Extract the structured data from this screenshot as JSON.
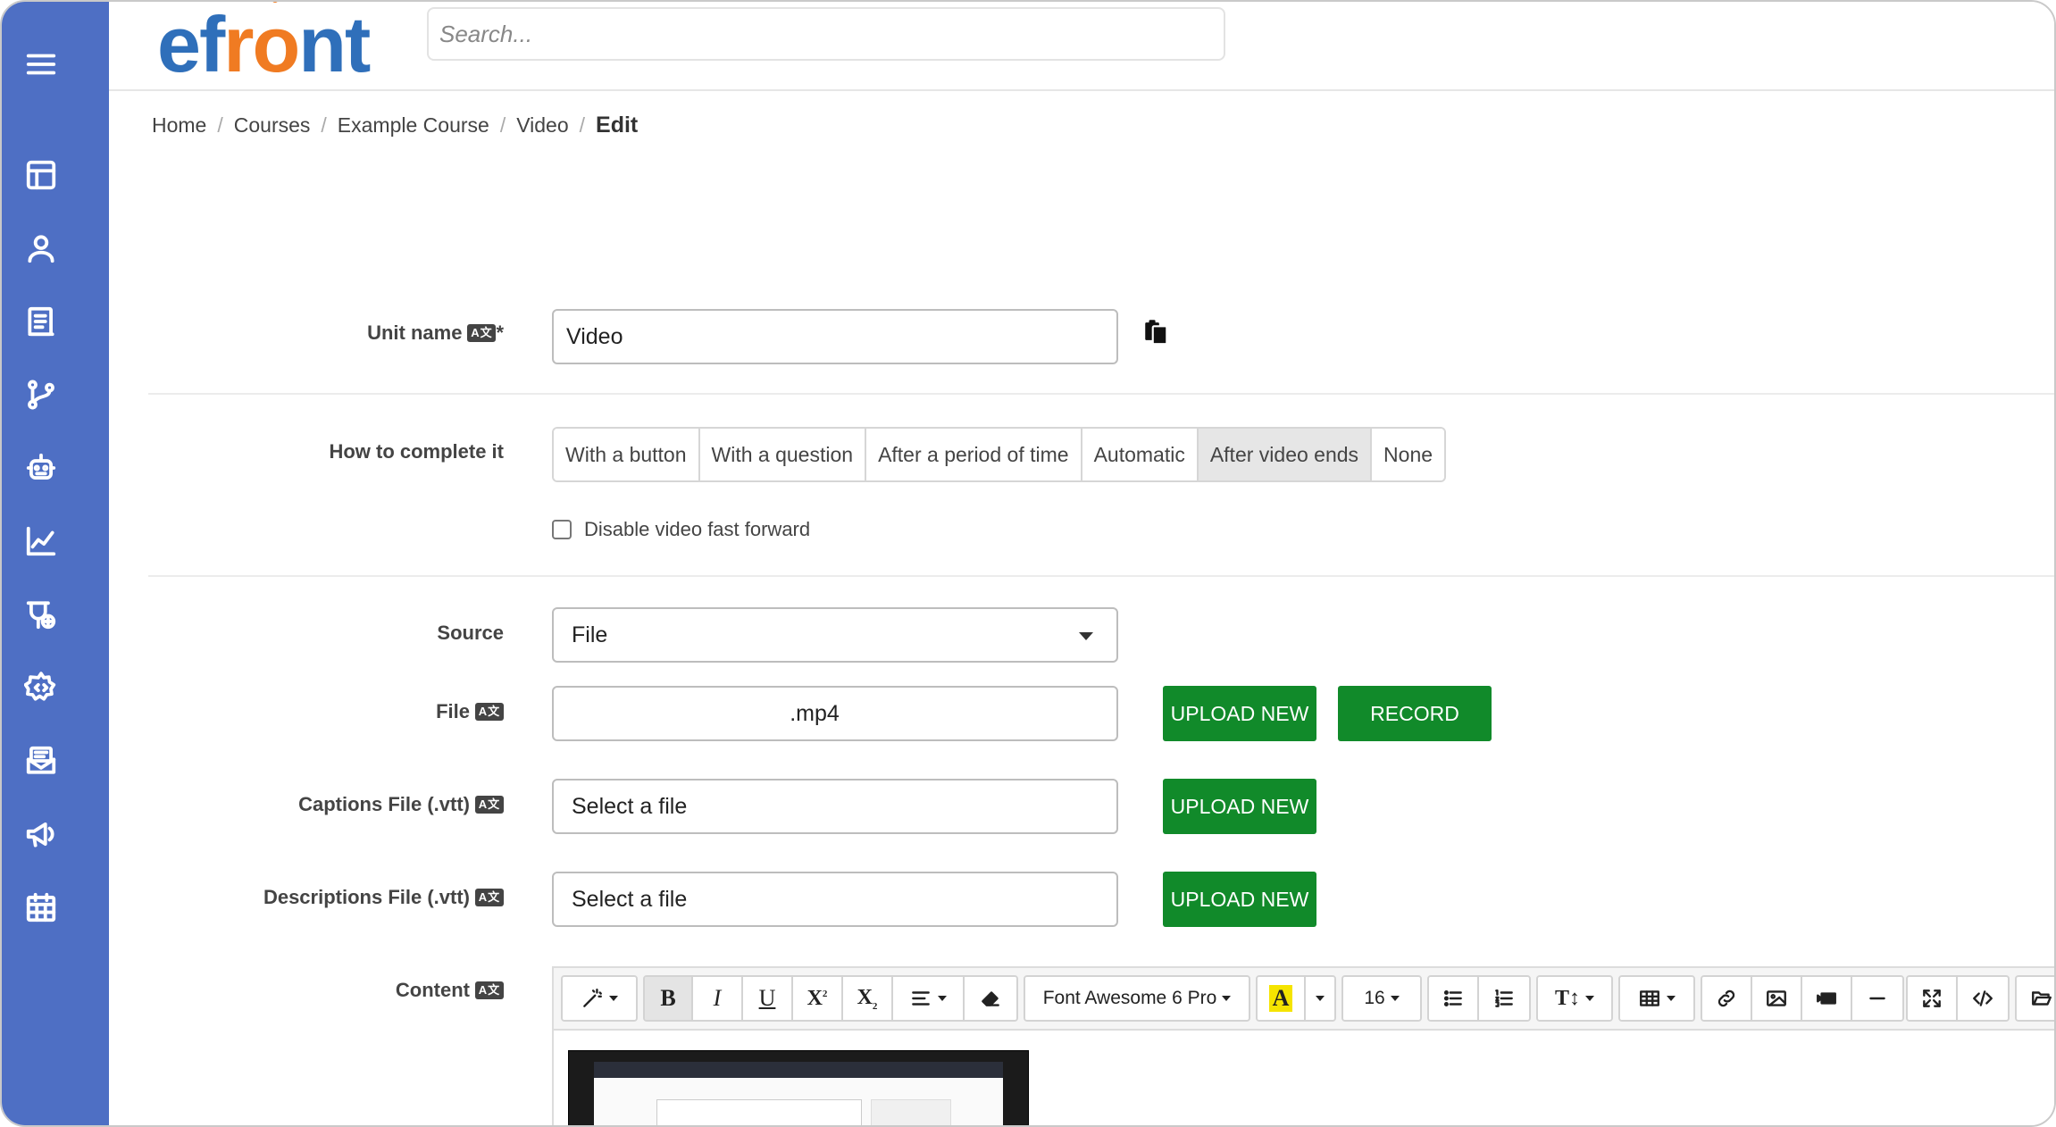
{
  "app": {
    "logo": {
      "part1": "ef",
      "part2": "r",
      "part3": "o",
      "part4": "nt"
    },
    "search": {
      "placeholder": "Search..."
    }
  },
  "sidebar": {
    "items": [
      {
        "name": "menu-icon"
      },
      {
        "name": "dashboard-icon"
      },
      {
        "name": "users-icon"
      },
      {
        "name": "courses-icon"
      },
      {
        "name": "learning-paths-icon"
      },
      {
        "name": "ai-robot-icon"
      },
      {
        "name": "reports-icon"
      },
      {
        "name": "integrations-icon"
      },
      {
        "name": "settings-icon"
      },
      {
        "name": "messages-icon"
      },
      {
        "name": "announcements-icon"
      },
      {
        "name": "calendar-icon"
      }
    ]
  },
  "breadcrumb": {
    "items": [
      "Home",
      "Courses",
      "Example Course",
      "Video"
    ],
    "current": "Edit",
    "separator": "/"
  },
  "form": {
    "unit_name": {
      "label": "Unit name",
      "required": "*",
      "value": "Video"
    },
    "completion": {
      "label": "How to complete it",
      "options": [
        "With a button",
        "With a question",
        "After a period of time",
        "Automatic",
        "After video ends",
        "None"
      ],
      "selected": "After video ends"
    },
    "disable_ff": {
      "label": "Disable video fast forward"
    },
    "source": {
      "label": "Source",
      "value": "File"
    },
    "file": {
      "label": "File",
      "value": ".mp4",
      "upload": "UPLOAD NEW",
      "record": "RECORD"
    },
    "captions": {
      "label": "Captions File (.vtt)",
      "value": "Select a file",
      "upload": "UPLOAD NEW"
    },
    "descriptions": {
      "label": "Descriptions File (.vtt)",
      "value": "Select a file",
      "upload": "UPLOAD NEW"
    },
    "content": {
      "label": "Content"
    },
    "lang_icon": "A文"
  },
  "editor": {
    "font_family": "Font Awesome 6 Pro",
    "font_size": "16"
  },
  "colors": {
    "sidebar": "#4e6fc4",
    "primary_green": "#118a2a",
    "logo_blue": "#2f6fba",
    "logo_orange": "#f07b22"
  }
}
